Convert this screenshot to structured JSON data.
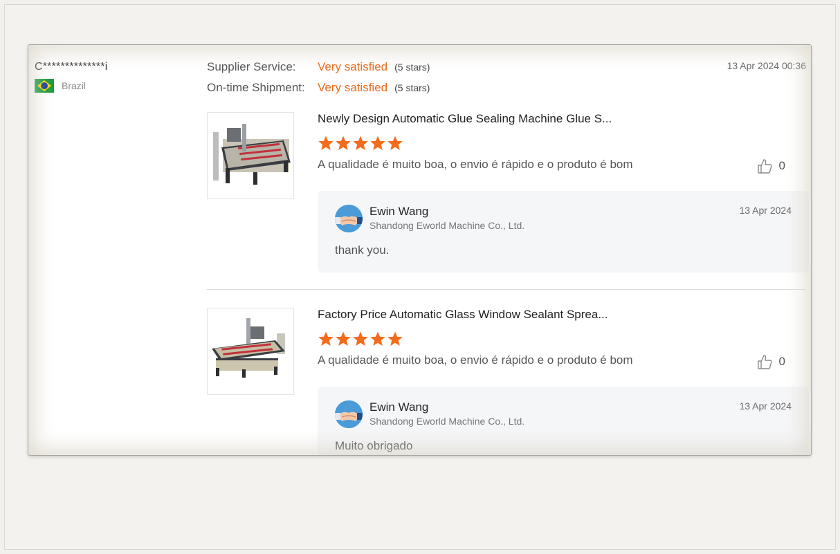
{
  "buyer": {
    "name": "C**************i",
    "country": "Brazil"
  },
  "ratings": [
    {
      "label": "Supplier Service:",
      "value": "Very satisfied",
      "stars": "(5 stars)"
    },
    {
      "label": "On-time Shipment:",
      "value": "Very satisfied",
      "stars": "(5 stars)"
    }
  ],
  "review_date": "13 Apr 2024 00:36",
  "reviews": [
    {
      "product_title": "Newly Design Automatic Glue Sealing Machine Glue S...",
      "rating": 5,
      "text": "A qualidade é muito boa, o envio é rápido e o produto é bom",
      "likes": "0",
      "reply": {
        "name": "Ewin Wang",
        "company": "Shandong Eworld Machine Co., Ltd.",
        "date": "13 Apr 2024",
        "text": "thank you."
      }
    },
    {
      "product_title": "Factory Price Automatic Glass Window Sealant Sprea...",
      "rating": 5,
      "text": "A qualidade é muito boa, o envio é rápido e o produto é bom",
      "likes": "0",
      "reply": {
        "name": "Ewin Wang",
        "company": "Shandong Eworld Machine Co., Ltd.",
        "date": "13 Apr 2024",
        "text": "Muito obrigado"
      }
    }
  ],
  "colors": {
    "accent": "#ea6a1b",
    "star": "#f26c1c",
    "reply_bg": "#f5f6f8"
  },
  "icons": [
    "brazil-flag-icon",
    "star-icon",
    "thumbs-up-icon",
    "handshake-avatar-icon"
  ]
}
